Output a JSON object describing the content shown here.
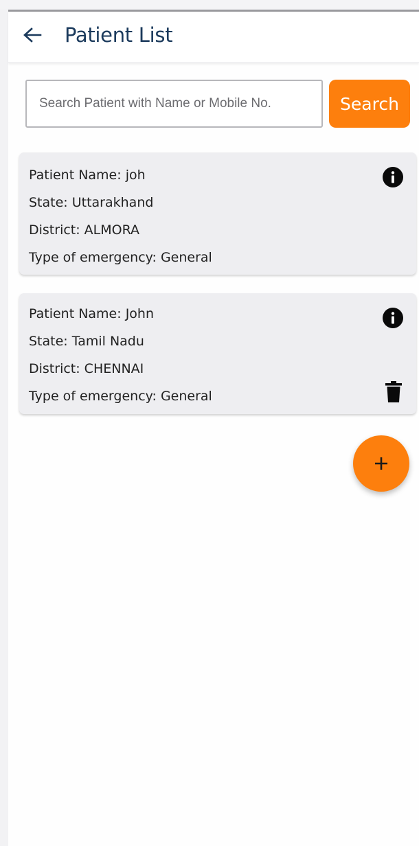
{
  "header": {
    "title": "Patient List",
    "back_icon": "arrow-left-icon"
  },
  "search": {
    "placeholder": "Search Patient with Name or Mobile No.",
    "value": "",
    "button_label": "Search"
  },
  "patients": [
    {
      "name_line": "Patient Name: joh",
      "state_line": "State: Uttarakhand",
      "district_line": "District: ALMORA",
      "emergency_line": "Type of emergency: General",
      "actions": [
        "info-icon"
      ]
    },
    {
      "name_line": "Patient Name: John",
      "state_line": "State: Tamil Nadu",
      "district_line": "District: CHENNAI",
      "emergency_line": "Type of emergency: General",
      "actions": [
        "info-icon",
        "trash-icon"
      ]
    }
  ],
  "fab": {
    "icon": "plus-icon"
  },
  "colors": {
    "accent": "#fd7f0d",
    "title": "#1b3a5c",
    "card_background": "#eeeef1"
  }
}
